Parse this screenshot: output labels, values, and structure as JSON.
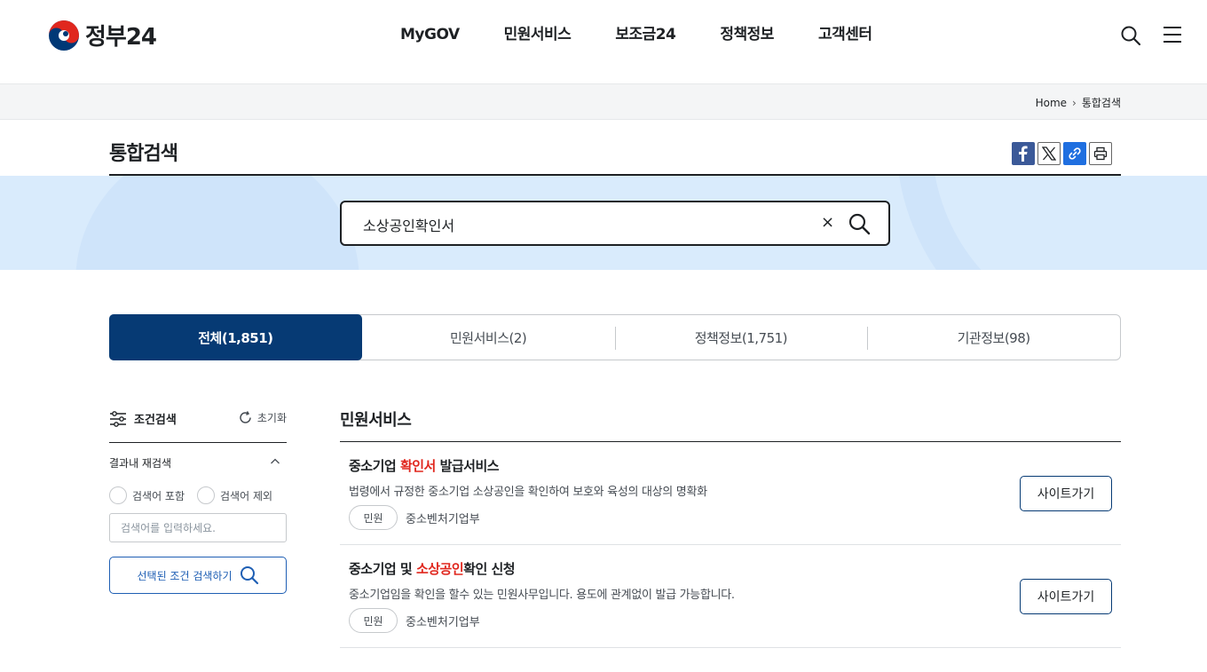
{
  "header": {
    "logo_text": "정부24",
    "nav": [
      "MyGOV",
      "민원서비스",
      "보조금24",
      "정책정보",
      "고객센터"
    ]
  },
  "breadcrumb": {
    "home": "Home",
    "current": "통합검색"
  },
  "page": {
    "title": "통합검색"
  },
  "share": [
    "facebook-icon",
    "x-icon",
    "link-icon",
    "print-icon"
  ],
  "search": {
    "value": "소상공인확인서",
    "clear": "×"
  },
  "tabs": [
    {
      "label": "전체(1,851)",
      "active": true
    },
    {
      "label": "민원서비스(2)"
    },
    {
      "label": "정책정보(1,751)"
    },
    {
      "label": "기관정보(98)"
    }
  ],
  "filter": {
    "title": "조건검색",
    "reset": "초기화",
    "refine_label": "결과내 재검색",
    "include": "검색어 포함",
    "exclude": "검색어 제외",
    "placeholder": "검색어를 입력하세요.",
    "button": "선택된 조건 검색하기"
  },
  "results": {
    "section_title": "민원서비스",
    "items": [
      {
        "title_pre": "중소기업 ",
        "title_hl": "확인서",
        "title_post": " 발급서비스",
        "desc": "법령에서 규정한 중소기업 소상공인을 확인하여 보호와 육성의 대상의 명확화",
        "tag": "민원",
        "org": "중소벤처기업부",
        "button": "사이트가기"
      },
      {
        "title_pre": "중소기업 및 ",
        "title_hl": "소상공인",
        "title_post": "확인 신청",
        "desc": "중소기업임을 확인을 할수 있는 민원사무입니다. 용도에 관계없이 발급 가능합니다.",
        "tag": "민원",
        "org": "중소벤처기업부",
        "button": "사이트가기"
      }
    ]
  },
  "colors": {
    "primary": "#063a74",
    "highlight": "#e0271e",
    "band": "#d9ebfc"
  }
}
